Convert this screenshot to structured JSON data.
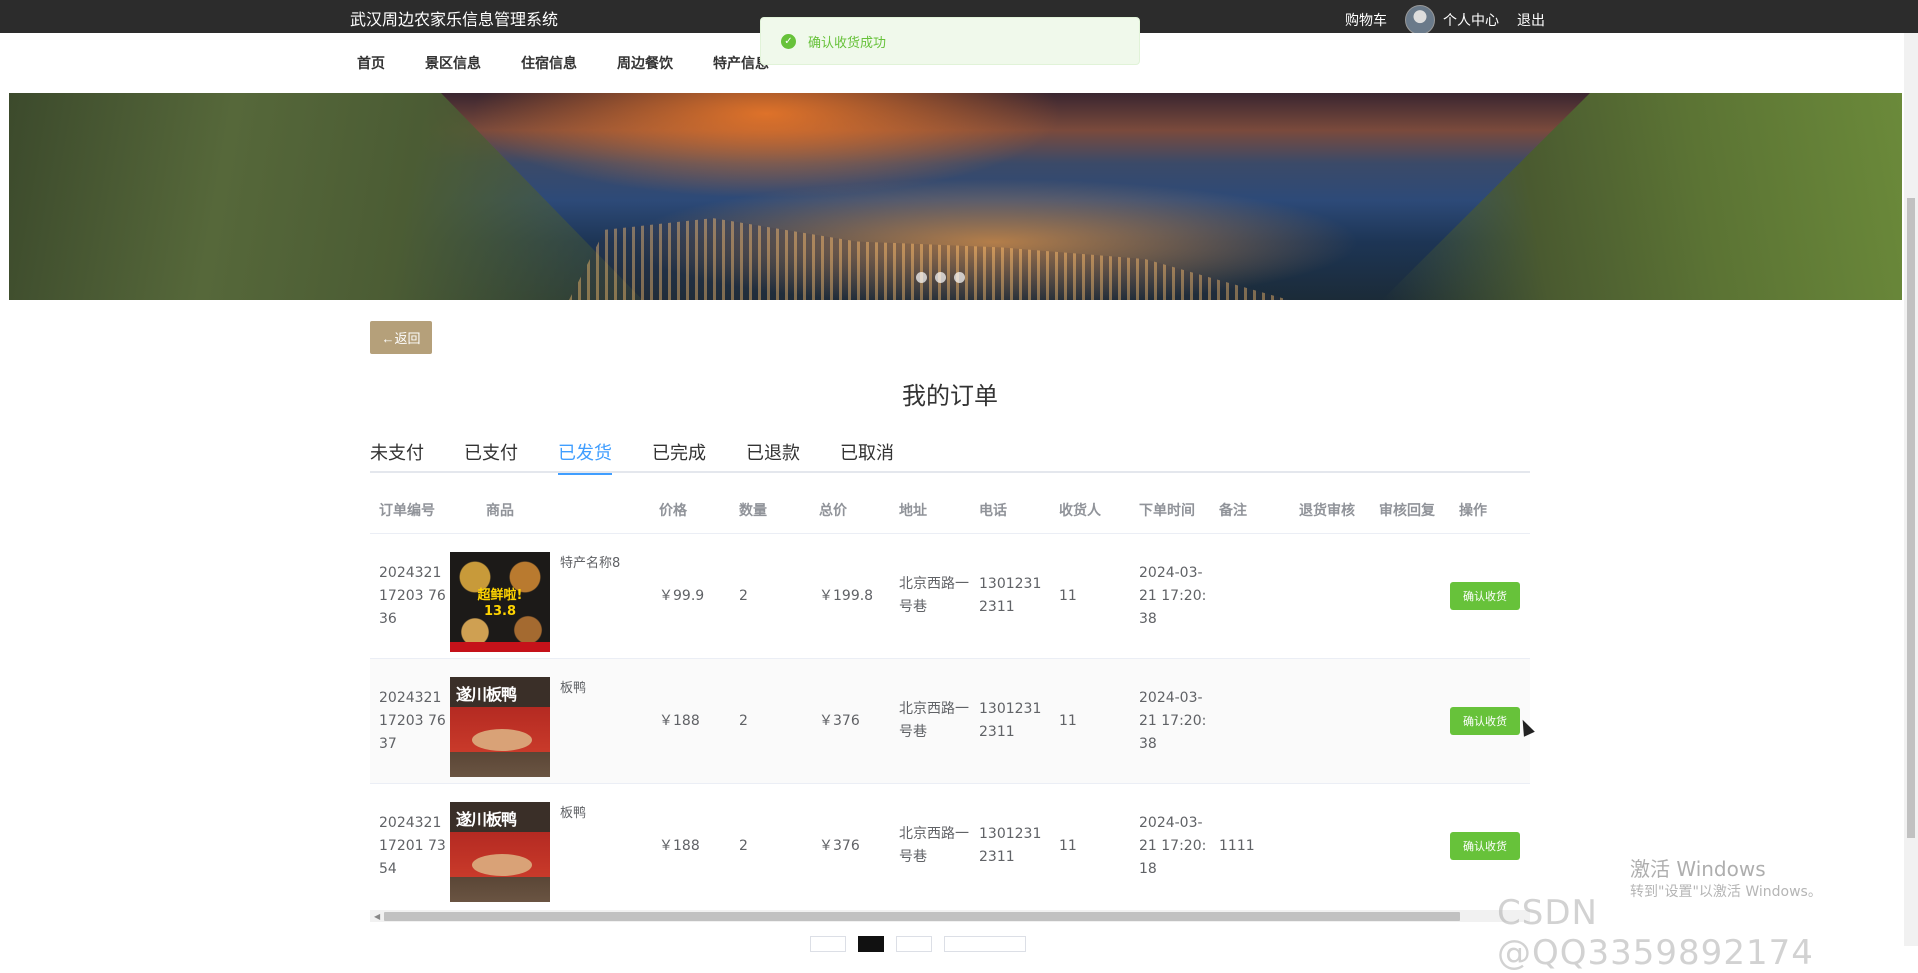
{
  "site": {
    "title": "武汉周边农家乐信息管理系统"
  },
  "top_links": {
    "cart": "购物车",
    "profile": "个人中心",
    "logout": "退出"
  },
  "nav": [
    "首页",
    "景区信息",
    "住宿信息",
    "周边餐饮",
    "特产信息"
  ],
  "toast": {
    "message": "确认收货成功"
  },
  "banner": {
    "active_slide": 1,
    "slide_count": 3
  },
  "back_button": {
    "label": "←返回"
  },
  "page_title": "我的订单",
  "tabs": [
    {
      "label": "未支付",
      "active": false
    },
    {
      "label": "已支付",
      "active": false
    },
    {
      "label": "已发货",
      "active": true
    },
    {
      "label": "已完成",
      "active": false
    },
    {
      "label": "已退款",
      "active": false
    },
    {
      "label": "已取消",
      "active": false
    }
  ],
  "table": {
    "headers": [
      "订单编号",
      "商品",
      "价格",
      "数量",
      "总价",
      "地址",
      "电话",
      "收货人",
      "下单时间",
      "备注",
      "退货审核",
      "审核回复",
      "操作"
    ],
    "rows": [
      {
        "id": "202432117203 7636",
        "product": "特产名称8",
        "image": "food",
        "price": "￥99.9",
        "qty": "2",
        "total": "￥199.8",
        "address": "北京西路一号巷",
        "phone": "13012312311",
        "receiver": "11",
        "time": "2024-03-21 17:20:38",
        "note": "",
        "refund": "",
        "reply": "",
        "action": "确认收货"
      },
      {
        "id": "202432117203 7637",
        "product": "板鸭",
        "image": "duck",
        "price": "￥188",
        "qty": "2",
        "total": "￥376",
        "address": "北京西路一号巷",
        "phone": "13012312311",
        "receiver": "11",
        "time": "2024-03-21 17:20:38",
        "note": "",
        "refund": "",
        "reply": "",
        "action": "确认收货"
      },
      {
        "id": "202432117201 7354",
        "product": "板鸭",
        "image": "duck",
        "price": "￥188",
        "qty": "2",
        "total": "￥376",
        "address": "北京西路一号巷",
        "phone": "13012312311",
        "receiver": "11",
        "time": "2024-03-21 17:20:18",
        "note": "1111",
        "refund": "",
        "reply": "",
        "action": "确认收货"
      }
    ]
  },
  "watermark": {
    "line1": "激活 Windows",
    "line2": "转到\"设置\"以激活 Windows。",
    "csdn": "CSDN @QQ3359892174"
  }
}
